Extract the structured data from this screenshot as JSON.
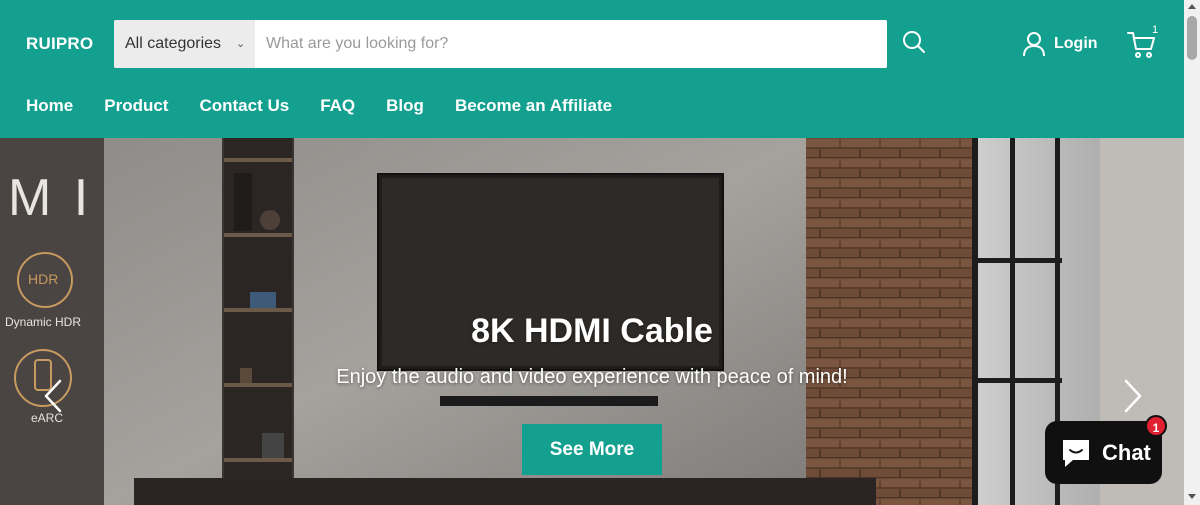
{
  "header": {
    "logo": "RUIPRO",
    "search": {
      "category": "All categories",
      "placeholder": "What are you looking for?",
      "value": ""
    },
    "login_label": "Login",
    "cart_count": "1"
  },
  "nav": {
    "items": [
      {
        "label": "Home"
      },
      {
        "label": "Product"
      },
      {
        "label": "Contact Us"
      },
      {
        "label": "FAQ"
      },
      {
        "label": "Blog"
      },
      {
        "label": "Become an Affiliate"
      }
    ]
  },
  "hero": {
    "title": "8K HDMI Cable",
    "subtitle": "Enjoy the audio and video experience with peace of mind!",
    "button": "See More",
    "side_panel": {
      "big_text": "M I",
      "hdr_badge": "HDR",
      "hdr_label": "Dynamic HDR",
      "earc_label": "eARC"
    }
  },
  "chat": {
    "label": "Chat",
    "badge": "1"
  },
  "colors": {
    "brand": "#14a08f",
    "chat_bg": "#101010",
    "badge": "#e02030"
  },
  "icons": {
    "search": "search-icon",
    "user": "user-icon",
    "cart": "cart-icon",
    "chat": "chat-bubble-icon",
    "prev": "chevron-left-icon",
    "next": "chevron-right-icon"
  }
}
